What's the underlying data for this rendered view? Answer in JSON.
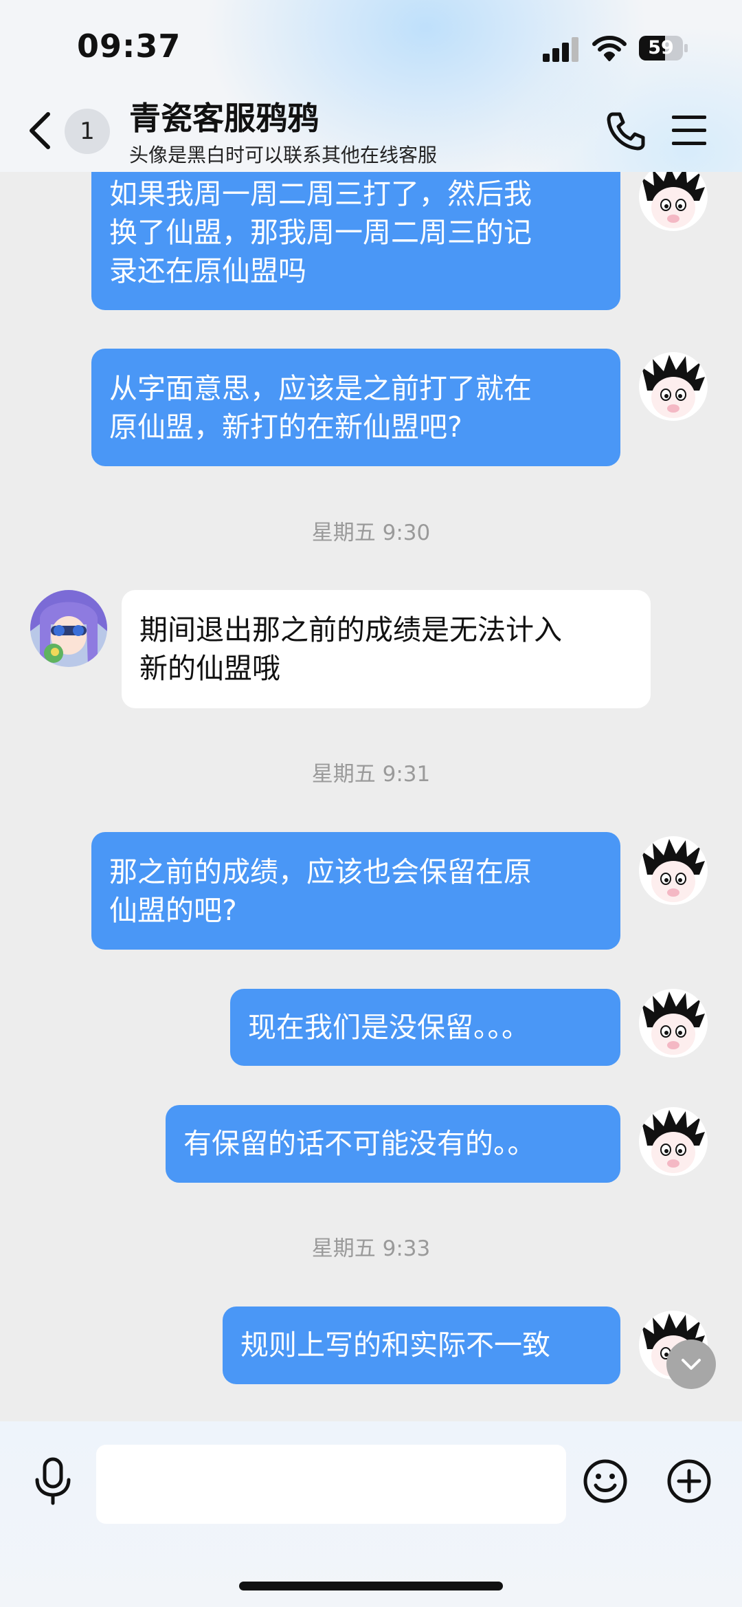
{
  "status_bar": {
    "time": "09:37",
    "battery": "59",
    "battery_level": 0.59
  },
  "header": {
    "unread_count": "1",
    "title": "青瓷客服鸦鸦",
    "subtitle": "头像是黑白时可以联系其他在线客服"
  },
  "messages": [
    {
      "side": "out",
      "lines": [
        "如果我周一周二周三打了，然后我",
        "换了仙盟，那我周一周二周三的记",
        "录还在原仙盟吗"
      ]
    },
    {
      "side": "out",
      "lines": [
        "从字面意思，应该是之前打了就在",
        "原仙盟，新打的在新仙盟吧?"
      ]
    },
    {
      "type": "time",
      "text": "星期五 9:30"
    },
    {
      "side": "in",
      "lines": [
        "期间退出那之前的成绩是无法计入",
        "新的仙盟哦"
      ]
    },
    {
      "type": "time",
      "text": "星期五 9:31"
    },
    {
      "side": "out",
      "lines": [
        "那之前的成绩，应该也会保留在原",
        "仙盟的吧?"
      ]
    },
    {
      "side": "out",
      "lines": [
        "现在我们是没保留。。。"
      ]
    },
    {
      "side": "out",
      "lines": [
        "有保留的话不可能没有的。。"
      ]
    },
    {
      "type": "time",
      "text": "星期五 9:33"
    },
    {
      "side": "out",
      "lines": [
        "规则上写的和实际不一致"
      ]
    }
  ],
  "input": {
    "placeholder": ""
  },
  "colors": {
    "outgoing_bubble": "#4a97f6",
    "incoming_bubble": "#ffffff",
    "background": "#ededed"
  }
}
